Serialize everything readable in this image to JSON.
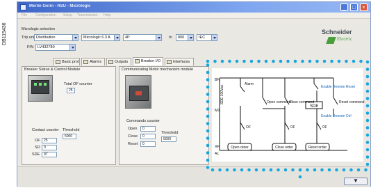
{
  "doc_id": "DB115436",
  "window": {
    "title": "Merlin Gerin - RSU - Micrologic",
    "controls": [
      "_",
      "□",
      "×"
    ]
  },
  "menu": [
    "File",
    "Configuration",
    "Setup",
    "Transmission",
    "Help"
  ],
  "selection": {
    "header": "Micrologic selection",
    "trip_unit_label": "Trip unit",
    "trip_unit_value": "Distribution",
    "micrologic_value": "Micrologic 6.3 A",
    "poles_value": "4P",
    "in_label": "In",
    "in_value": "800",
    "standard_value": "IEC",
    "p_n_label": "P/N",
    "p_n_value": "LV432780"
  },
  "logo": {
    "line1": "Schneider",
    "line2": "Electric"
  },
  "tabs": [
    {
      "label": "Basic prot",
      "active": false
    },
    {
      "label": "Alarms",
      "active": false
    },
    {
      "label": "Outputs",
      "active": false
    },
    {
      "label": "Breaker I/O",
      "active": true
    },
    {
      "label": "Interfaces",
      "active": false
    }
  ],
  "breaker_panel": {
    "title": "Breaker Status & Control Module",
    "total_of_counter_label": "Total OF counter",
    "total_of_counter_value": "25",
    "contact_counter_label": "Contact counter",
    "threshold_label": "Threshold",
    "threshold_value": "5000",
    "rows": [
      {
        "label": "OF",
        "value": "25"
      },
      {
        "label": "SD",
        "value": "0"
      },
      {
        "label": "SDE",
        "value": "97"
      }
    ]
  },
  "mech_panel": {
    "title": "Communicating Motor mechanism module",
    "commands_counter_label": "Commands counter",
    "threshold_label": "Threshold",
    "threshold_value": "5000",
    "rows": [
      {
        "label": "Open",
        "value": "0"
      },
      {
        "label": "Close",
        "value": "0"
      },
      {
        "label": "Reset",
        "value": "0"
      }
    ]
  },
  "diagram": {
    "left_labels": [
      "BN",
      "MX",
      "XF"
    ],
    "vertical_label": "SDE 100Vac",
    "switch_labels": [
      "Alarm",
      "Open command",
      "Close command",
      "Enable Remote Reset",
      "Reset command",
      "Enable Remote Ctrl"
    ],
    "relay_label": "SDE",
    "of_labels": [
      "OF",
      "OF",
      "OF"
    ],
    "bottom_buttons": [
      "Open order",
      "Close order",
      "Reset order"
    ],
    "a1_label": "A1",
    "highlight_color": "#16a6df"
  },
  "bottom": {
    "scroll_button": "▼"
  }
}
